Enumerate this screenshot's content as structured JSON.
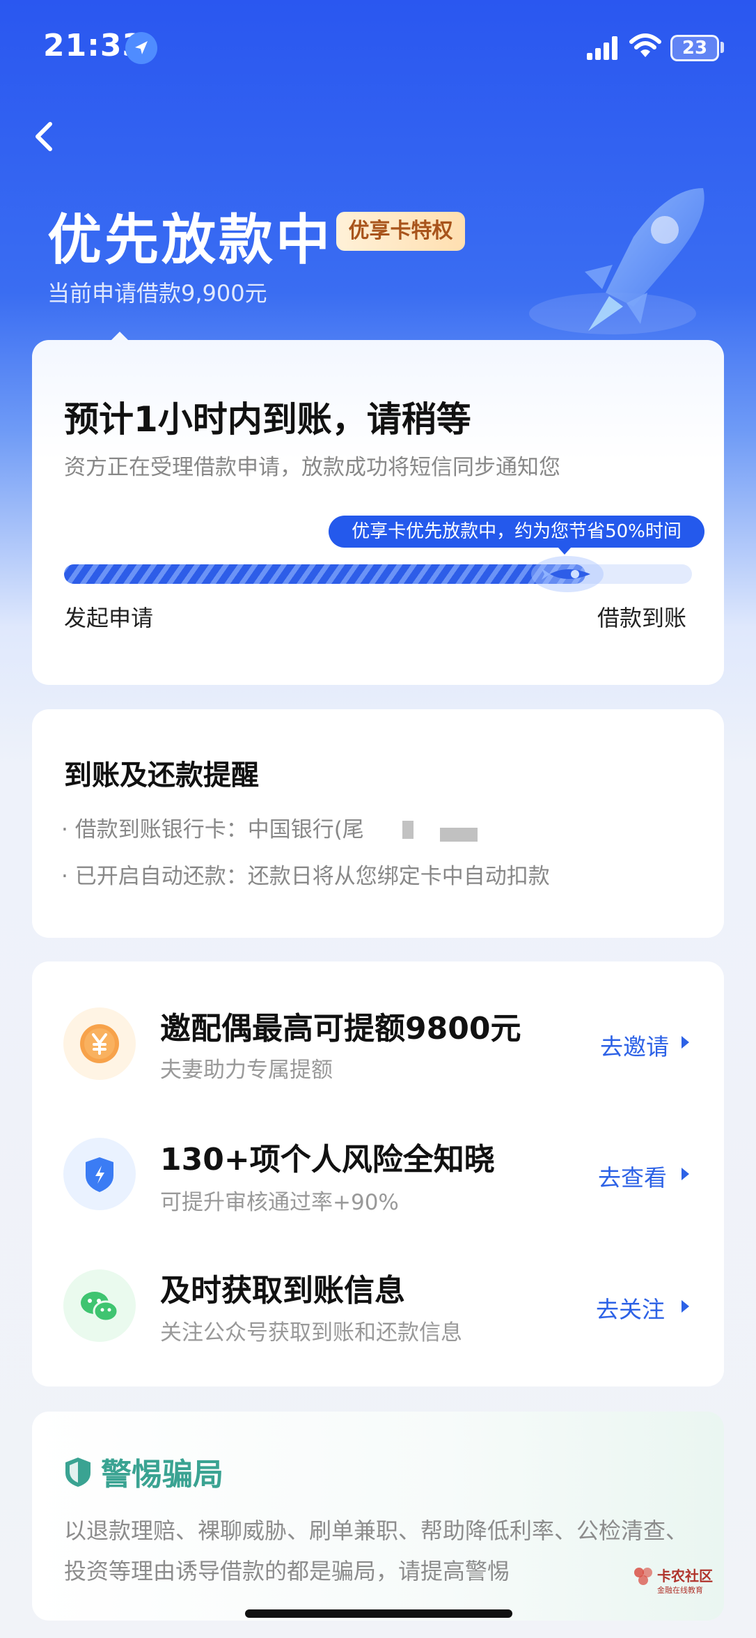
{
  "status_bar": {
    "time": "21:33",
    "battery": "23"
  },
  "header": {
    "title": "优先放款中",
    "badge": "优享卡特权",
    "subtitle": "当前申请借款9,900元"
  },
  "progress_card": {
    "title": "预计1小时内到账，请稍等",
    "subtitle": "资方正在受理借款申请，放款成功将短信同步通知您",
    "tooltip": "优享卡优先放款中，约为您节省50%时间",
    "progress": 0.83,
    "start_label": "发起申请",
    "end_label": "借款到账"
  },
  "reminder_card": {
    "title": "到账及还款提醒",
    "items": [
      "· 借款到账银行卡：中国银行(尾",
      "· 已开启自动还款：还款日将从您绑定卡中自动扣款"
    ]
  },
  "offers": [
    {
      "title": "邀配偶最高可提额9800元",
      "subtitle": "夫妻助力专属提额",
      "action": "去邀请",
      "icon": "yuan-coin-icon"
    },
    {
      "title": "130+项个人风险全知晓",
      "subtitle": "可提升审核通过率+90%",
      "action": "去查看",
      "icon": "shield-lightning-icon"
    },
    {
      "title": "及时获取到账信息",
      "subtitle": "关注公众号获取到账和还款信息",
      "action": "去关注",
      "icon": "wechat-icon"
    }
  ],
  "fraud_card": {
    "title": "警惕骗局",
    "text": "以退款理赔、裸聊威胁、刷单兼职、帮助降低利率、公检清查、投资等理由诱导借款的都是骗局，请提高警惕"
  },
  "watermark": {
    "name": "卡农社区",
    "tagline": "金融在线教育"
  },
  "colors": {
    "primary": "#2d62e6",
    "hero_blue": "#2a57f0",
    "fraud_green": "#3aa392",
    "coin_orange": "#f7a24a"
  }
}
